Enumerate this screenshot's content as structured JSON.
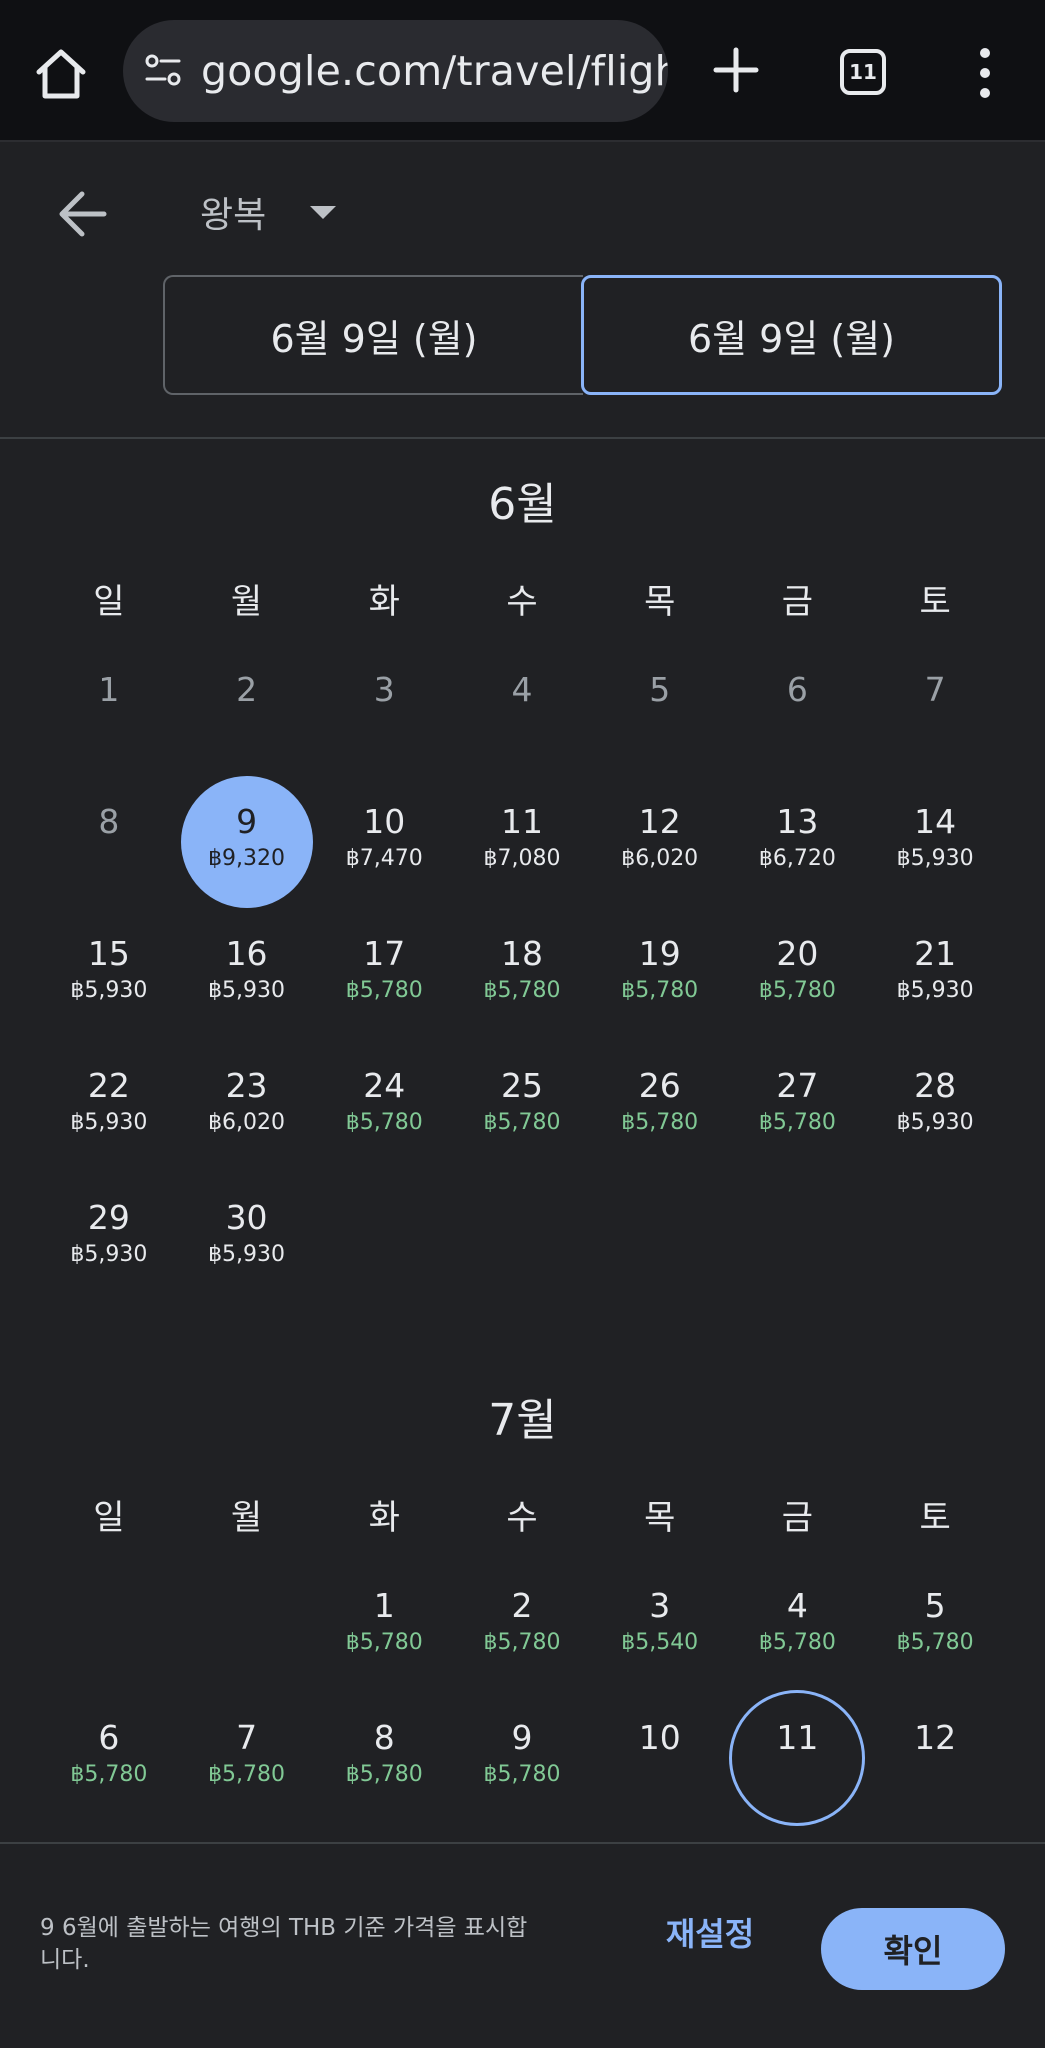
{
  "browser": {
    "url": "google.com/travel/fligh",
    "tab_count": "11"
  },
  "header": {
    "trip_type": "왕복",
    "depart_date": "6월 9일 (월)",
    "return_date": "6월 9일 (월)"
  },
  "weekdays": [
    "일",
    "월",
    "화",
    "수",
    "목",
    "금",
    "토"
  ],
  "june": {
    "title": "6월",
    "offset": 0,
    "days": [
      {
        "d": "1",
        "p": "",
        "past": true
      },
      {
        "d": "2",
        "p": "",
        "past": true
      },
      {
        "d": "3",
        "p": "",
        "past": true
      },
      {
        "d": "4",
        "p": "",
        "past": true
      },
      {
        "d": "5",
        "p": "",
        "past": true
      },
      {
        "d": "6",
        "p": "",
        "past": true
      },
      {
        "d": "7",
        "p": "",
        "past": true
      },
      {
        "d": "8",
        "p": "",
        "past": true
      },
      {
        "d": "9",
        "p": "฿9,320",
        "selected": true
      },
      {
        "d": "10",
        "p": "฿7,470"
      },
      {
        "d": "11",
        "p": "฿7,080"
      },
      {
        "d": "12",
        "p": "฿6,020"
      },
      {
        "d": "13",
        "p": "฿6,720"
      },
      {
        "d": "14",
        "p": "฿5,930"
      },
      {
        "d": "15",
        "p": "฿5,930"
      },
      {
        "d": "16",
        "p": "฿5,930"
      },
      {
        "d": "17",
        "p": "฿5,780",
        "cheap": true
      },
      {
        "d": "18",
        "p": "฿5,780",
        "cheap": true
      },
      {
        "d": "19",
        "p": "฿5,780",
        "cheap": true
      },
      {
        "d": "20",
        "p": "฿5,780",
        "cheap": true
      },
      {
        "d": "21",
        "p": "฿5,930"
      },
      {
        "d": "22",
        "p": "฿5,930"
      },
      {
        "d": "23",
        "p": "฿6,020"
      },
      {
        "d": "24",
        "p": "฿5,780",
        "cheap": true
      },
      {
        "d": "25",
        "p": "฿5,780",
        "cheap": true
      },
      {
        "d": "26",
        "p": "฿5,780",
        "cheap": true
      },
      {
        "d": "27",
        "p": "฿5,780",
        "cheap": true
      },
      {
        "d": "28",
        "p": "฿5,930"
      },
      {
        "d": "29",
        "p": "฿5,930"
      },
      {
        "d": "30",
        "p": "฿5,930"
      }
    ]
  },
  "july": {
    "title": "7월",
    "offset": 2,
    "days": [
      {
        "d": "1",
        "p": "฿5,780",
        "cheap": true
      },
      {
        "d": "2",
        "p": "฿5,780",
        "cheap": true
      },
      {
        "d": "3",
        "p": "฿5,540",
        "cheap": true
      },
      {
        "d": "4",
        "p": "฿5,780",
        "cheap": true
      },
      {
        "d": "5",
        "p": "฿5,780",
        "cheap": true
      },
      {
        "d": "6",
        "p": "฿5,780",
        "cheap": true
      },
      {
        "d": "7",
        "p": "฿5,780",
        "cheap": true
      },
      {
        "d": "8",
        "p": "฿5,780",
        "cheap": true
      },
      {
        "d": "9",
        "p": "฿5,780",
        "cheap": true
      },
      {
        "d": "10",
        "p": ""
      },
      {
        "d": "11",
        "p": "",
        "ringed": true
      },
      {
        "d": "12",
        "p": ""
      }
    ]
  },
  "footer": {
    "note": "9 6월에 출발하는 여행의 THB 기준 가격을 표시합니다.",
    "reset_label": "재설정",
    "confirm_label": "확인"
  },
  "colors": {
    "background": "#202124",
    "accent": "#8ab4f8",
    "cheap_price": "#81c995"
  }
}
